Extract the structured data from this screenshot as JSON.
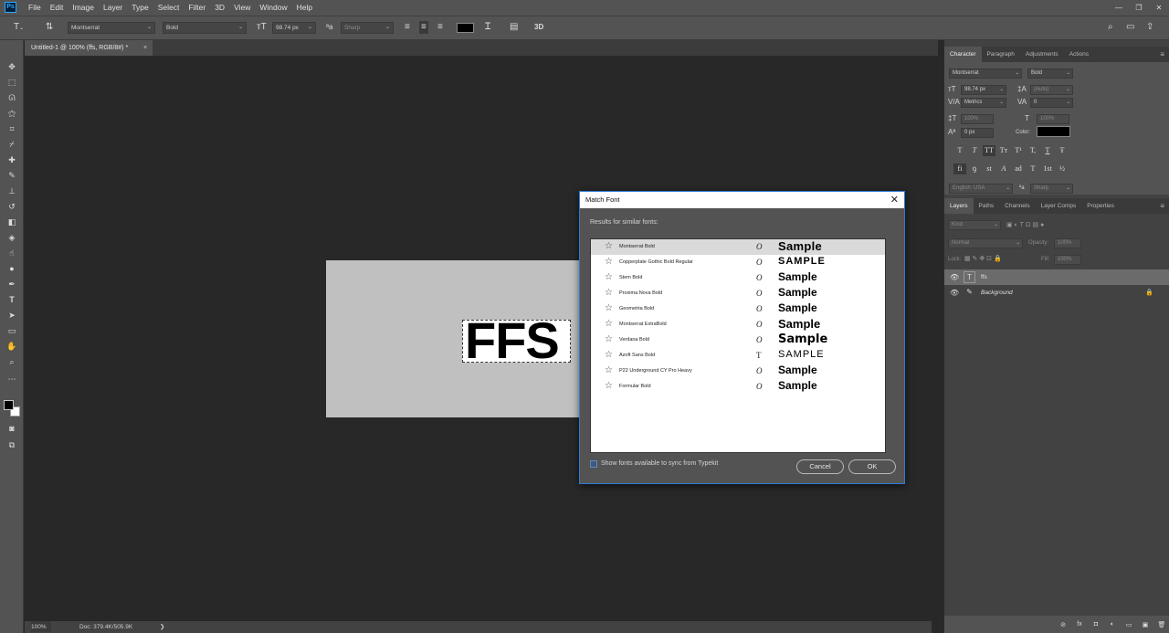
{
  "app": {
    "logo": "Ps"
  },
  "menu": [
    "File",
    "Edit",
    "Image",
    "Layer",
    "Type",
    "Select",
    "Filter",
    "3D",
    "View",
    "Window",
    "Help"
  ],
  "window_controls": [
    "—",
    "❐",
    "✕"
  ],
  "options_bar": {
    "font_family": "Montserrat",
    "font_style": "Bold",
    "font_size": "98.74 px",
    "antialias": "Sharp",
    "text_color": "#000000",
    "threed_label": "3D"
  },
  "doc_tab": {
    "title": "Untitled-1 @ 100% (ffs, RGB/8#) *",
    "close": "×"
  },
  "canvas": {
    "text": "FFS"
  },
  "status": {
    "zoom": "100%",
    "doc": "Doc: 379.4K/505.9K",
    "arrow": "❯"
  },
  "character_panel": {
    "tabs": [
      "Character",
      "Paragraph",
      "Adjustments",
      "Actions"
    ],
    "font_family": "Montserrat",
    "font_style": "Bold",
    "size": "98.74 px",
    "leading": "(Auto)",
    "kerning": "Metrics",
    "tracking": "0",
    "vscale": "100%",
    "hscale": "100%",
    "baseline": "0 px",
    "color_label": "Color:",
    "language": "English: USA",
    "antialias": "Sharp",
    "style_buttons": [
      "T",
      "T",
      "TT",
      "Tт",
      "T¹",
      "T,",
      "T",
      "Ŧ"
    ],
    "opentype_buttons": [
      "fi",
      "ꝯ",
      "st",
      "A",
      "ad",
      "T",
      "1st",
      "½"
    ]
  },
  "layers_panel": {
    "tabs": [
      "Layers",
      "Paths",
      "Channels",
      "Layer Comps",
      "Properties"
    ],
    "kind": "Kind",
    "blend": "Normal",
    "opacity_label": "Opacity:",
    "opacity": "100%",
    "lock_label": "Lock:",
    "fill_label": "Fill:",
    "fill": "100%",
    "layers": [
      {
        "name": "ffs",
        "thumb": "T",
        "selected": true
      },
      {
        "name": "Background",
        "thumb": "✎",
        "selected": false
      }
    ],
    "bottom_icons": [
      "⊘",
      "fx",
      "◘",
      "◐",
      "▭",
      "▣",
      "🗑"
    ]
  },
  "dialog": {
    "title": "Match Font",
    "subtitle": "Results for similar fonts:",
    "fonts": [
      {
        "name": "Montserrat Bold",
        "type": "O",
        "sample": "Sample"
      },
      {
        "name": "Copperplate Gothic Bold Regular",
        "type": "O",
        "sample": "SAMPLE"
      },
      {
        "name": "Stem Bold",
        "type": "O",
        "sample": "Sample"
      },
      {
        "name": "Proxima Nova Bold",
        "type": "O",
        "sample": "Sample"
      },
      {
        "name": "Geometria Bold",
        "type": "O",
        "sample": "Sample"
      },
      {
        "name": "Montserrat ExtraBold",
        "type": "O",
        "sample": "Sample"
      },
      {
        "name": "Verdana Bold",
        "type": "O",
        "sample": "Sample"
      },
      {
        "name": "Azoft Sans Bold",
        "type": "T",
        "sample": "SAMPLE"
      },
      {
        "name": "P22 Underground CY Pro Heavy",
        "type": "O",
        "sample": "Sample"
      },
      {
        "name": "Formular Bold",
        "type": "O",
        "sample": "Sample"
      }
    ],
    "sync_label": "Show fonts available to sync from Typekit",
    "cancel": "Cancel",
    "ok": "OK"
  }
}
